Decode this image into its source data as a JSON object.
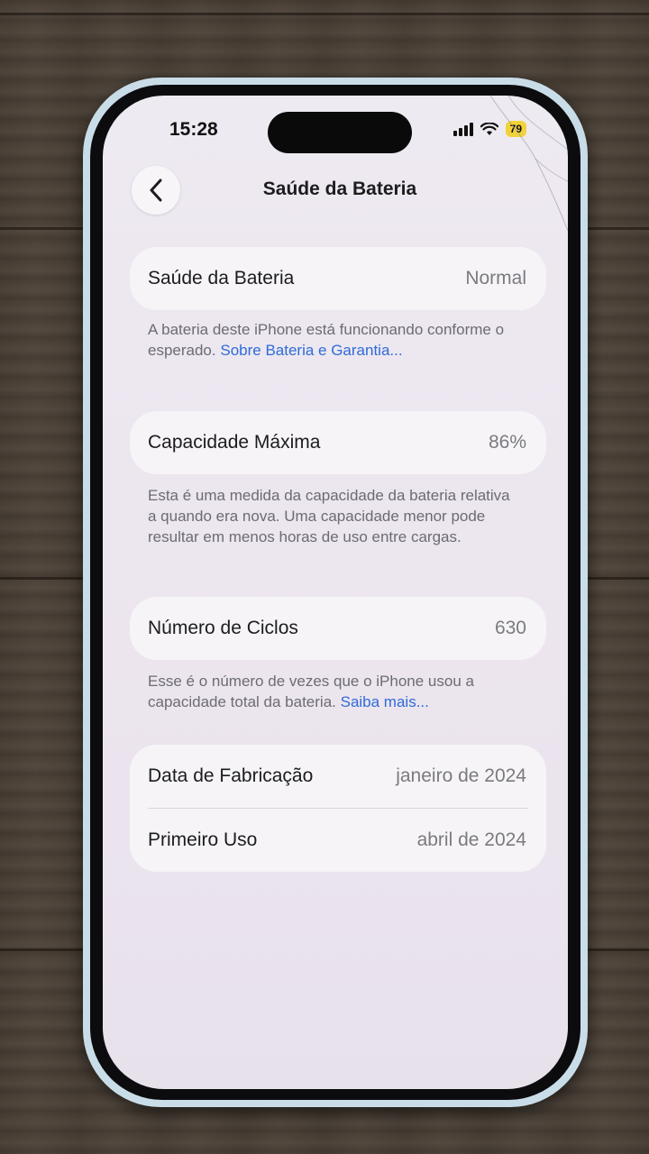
{
  "status_bar": {
    "time": "15:28",
    "battery_level": "79"
  },
  "nav": {
    "title": "Saúde da Bateria"
  },
  "battery_health": {
    "label": "Saúde da Bateria",
    "value": "Normal",
    "note": "A bateria deste iPhone está funcionando conforme o esperado.",
    "link": "Sobre Bateria e Garantia..."
  },
  "max_capacity": {
    "label": "Capacidade Máxima",
    "value": "86%",
    "note": "Esta é uma medida da capacidade da bateria relativa a quando era nova. Uma capacidade menor pode resultar em menos horas de uso entre cargas."
  },
  "cycle_count": {
    "label": "Número de Ciclos",
    "value": "630",
    "note": "Esse é o número de vezes que o iPhone usou a capacidade total da bateria.",
    "link": "Saiba mais..."
  },
  "dates": {
    "manufacture_label": "Data de Fabricação",
    "manufacture_value": "janeiro de 2024",
    "first_use_label": "Primeiro Uso",
    "first_use_value": "abril de 2024"
  },
  "colors": {
    "link": "#2f6bd8",
    "battery_badge": "#f2d23a"
  }
}
